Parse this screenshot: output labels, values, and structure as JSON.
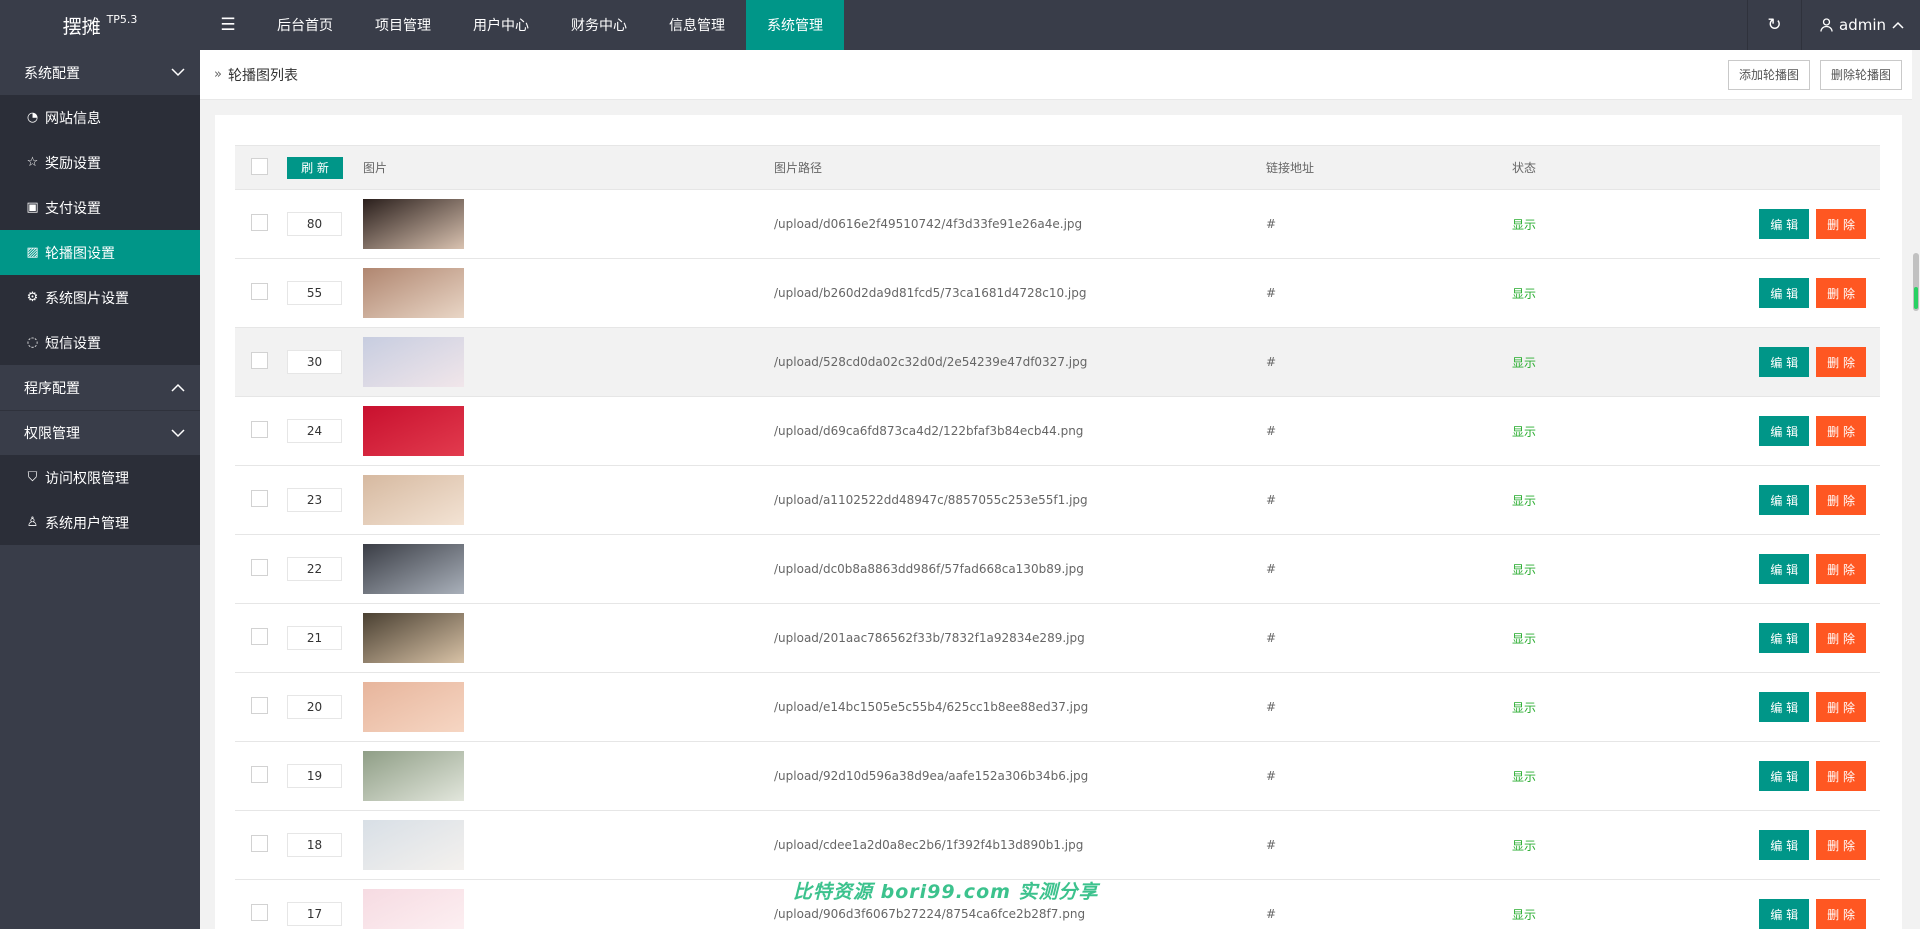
{
  "logo": {
    "name": "摆摊",
    "version": "TP5.3"
  },
  "topnav": [
    "后台首页",
    "项目管理",
    "用户中心",
    "财务中心",
    "信息管理",
    "系统管理"
  ],
  "user": {
    "name": "admin"
  },
  "sidebar": {
    "group1": "系统配置",
    "group1_items": [
      "网站信息",
      "奖励设置",
      "支付设置",
      "轮播图设置",
      "系统图片设置",
      "短信设置"
    ],
    "group2": "程序配置",
    "group3": "权限管理",
    "group3_items": [
      "访问权限管理",
      "系统用户管理"
    ]
  },
  "breadcrumb": "轮播图列表",
  "actions": {
    "add": "添加轮播图",
    "delete": "删除轮播图"
  },
  "table": {
    "refresh": "刷 新",
    "headers": {
      "image": "图片",
      "path": "图片路径",
      "link": "链接地址",
      "status": "状态"
    },
    "edit_label": "编 辑",
    "delete_label": "删 除",
    "rows": [
      {
        "sort": "80",
        "path": "/upload/d0616e2f49510742/4f3d33fe91e26a4e.jpg",
        "link": "#",
        "status": "显示"
      },
      {
        "sort": "55",
        "path": "/upload/b260d2da9d81fcd5/73ca1681d4728c10.jpg",
        "link": "#",
        "status": "显示"
      },
      {
        "sort": "30",
        "path": "/upload/528cd0da02c32d0d/2e54239e47df0327.jpg",
        "link": "#",
        "status": "显示"
      },
      {
        "sort": "24",
        "path": "/upload/d69ca6fd873ca4d2/122bfaf3b84ecb44.png",
        "link": "#",
        "status": "显示"
      },
      {
        "sort": "23",
        "path": "/upload/a1102522dd48947c/8857055c253e55f1.jpg",
        "link": "#",
        "status": "显示"
      },
      {
        "sort": "22",
        "path": "/upload/dc0b8a8863dd986f/57fad668ca130b89.jpg",
        "link": "#",
        "status": "显示"
      },
      {
        "sort": "21",
        "path": "/upload/201aac786562f33b/7832f1a92834e289.jpg",
        "link": "#",
        "status": "显示"
      },
      {
        "sort": "20",
        "path": "/upload/e14bc1505e5c55b4/625cc1b8ee88ed37.jpg",
        "link": "#",
        "status": "显示"
      },
      {
        "sort": "19",
        "path": "/upload/92d10d596a38d9ea/aafe152a306b34b6.jpg",
        "link": "#",
        "status": "显示"
      },
      {
        "sort": "18",
        "path": "/upload/cdee1a2d0a8ec2b6/1f392f4b13d890b1.jpg",
        "link": "#",
        "status": "显示"
      },
      {
        "sort": "17",
        "path": "/upload/906d3f6067b27224/8754ca6fce2b28f7.png",
        "link": "#",
        "status": "显示"
      }
    ]
  },
  "watermark": "比特资源 bori99.com 实测分享",
  "colors": {
    "header": "#393d49",
    "accent": "#009688",
    "danger": "#ff5722",
    "status": "#2aad30"
  }
}
